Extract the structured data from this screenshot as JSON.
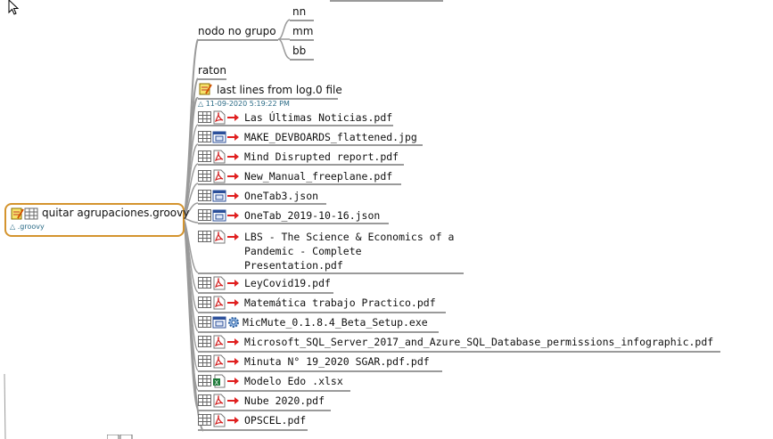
{
  "root": {
    "label": "quitar agrupaciones.groovy",
    "attribute": ".groovy"
  },
  "group_node": {
    "label": "nodo no grupo",
    "children": [
      "nn",
      "mm",
      "bb"
    ]
  },
  "raton": {
    "label": "raton"
  },
  "log_node": {
    "label": "last lines from log.0 file",
    "timestamp": "11-09-2020  5:19:22 PM"
  },
  "files": [
    {
      "name": "Las Últimas Noticias.pdf",
      "type": "pdf"
    },
    {
      "name": "MAKE_DEVBOARDS_flattened.jpg",
      "type": "window"
    },
    {
      "name": "Mind Disrupted report.pdf",
      "type": "pdf"
    },
    {
      "name": "New_Manual_freeplane.pdf",
      "type": "pdf"
    },
    {
      "name": "OneTab3.json",
      "type": "window"
    },
    {
      "name": "OneTab_2019-10-16.json",
      "type": "window"
    },
    {
      "name": "LBS - The Science & Economics of a",
      "name2": "Pandemic - Complete",
      "name3": "Presentation.pdf",
      "type": "pdf"
    },
    {
      "name": "LeyCovid19.pdf",
      "type": "pdf"
    },
    {
      "name": "Matemática trabajo Practico.pdf",
      "type": "pdf"
    },
    {
      "name": "MicMute_0.1.8.4_Beta_Setup.exe",
      "type": "exe"
    },
    {
      "name": "Microsoft_SQL_Server_2017_and_Azure_SQL_Database_permissions_infographic.pdf",
      "type": "pdf"
    },
    {
      "name": "Minuta N° 19_2020  SGAR.pdf.pdf",
      "type": "pdf"
    },
    {
      "name": "Modelo Edo .xlsx",
      "type": "xlsx"
    },
    {
      "name": "Nube 2020.pdf",
      "type": "pdf"
    },
    {
      "name": "OPSCEL.pdf",
      "type": "pdf"
    }
  ],
  "colors": {
    "root_border": "#d4942e",
    "edge": "#9a9a9a",
    "arrow": "#e02020",
    "attribute_text": "#2a6b86"
  }
}
